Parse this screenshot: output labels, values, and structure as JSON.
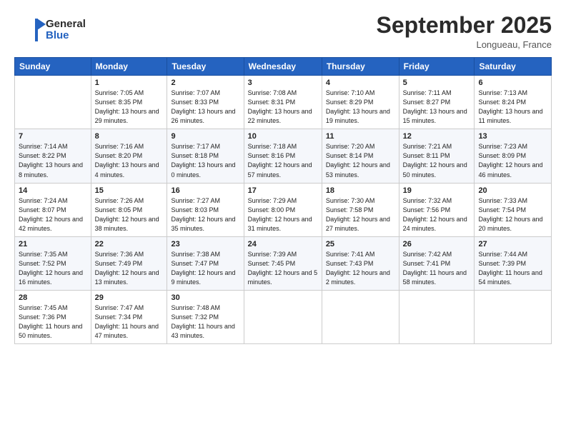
{
  "header": {
    "logo_line1": "General",
    "logo_line2": "Blue",
    "month": "September 2025",
    "location": "Longueau, France"
  },
  "days_of_week": [
    "Sunday",
    "Monday",
    "Tuesday",
    "Wednesday",
    "Thursday",
    "Friday",
    "Saturday"
  ],
  "weeks": [
    [
      {
        "day": "",
        "content": ""
      },
      {
        "day": "1",
        "content": "Sunrise: 7:05 AM\nSunset: 8:35 PM\nDaylight: 13 hours and 29 minutes."
      },
      {
        "day": "2",
        "content": "Sunrise: 7:07 AM\nSunset: 8:33 PM\nDaylight: 13 hours and 26 minutes."
      },
      {
        "day": "3",
        "content": "Sunrise: 7:08 AM\nSunset: 8:31 PM\nDaylight: 13 hours and 22 minutes."
      },
      {
        "day": "4",
        "content": "Sunrise: 7:10 AM\nSunset: 8:29 PM\nDaylight: 13 hours and 19 minutes."
      },
      {
        "day": "5",
        "content": "Sunrise: 7:11 AM\nSunset: 8:27 PM\nDaylight: 13 hours and 15 minutes."
      },
      {
        "day": "6",
        "content": "Sunrise: 7:13 AM\nSunset: 8:24 PM\nDaylight: 13 hours and 11 minutes."
      }
    ],
    [
      {
        "day": "7",
        "content": "Sunrise: 7:14 AM\nSunset: 8:22 PM\nDaylight: 13 hours and 8 minutes."
      },
      {
        "day": "8",
        "content": "Sunrise: 7:16 AM\nSunset: 8:20 PM\nDaylight: 13 hours and 4 minutes."
      },
      {
        "day": "9",
        "content": "Sunrise: 7:17 AM\nSunset: 8:18 PM\nDaylight: 13 hours and 0 minutes."
      },
      {
        "day": "10",
        "content": "Sunrise: 7:18 AM\nSunset: 8:16 PM\nDaylight: 12 hours and 57 minutes."
      },
      {
        "day": "11",
        "content": "Sunrise: 7:20 AM\nSunset: 8:14 PM\nDaylight: 12 hours and 53 minutes."
      },
      {
        "day": "12",
        "content": "Sunrise: 7:21 AM\nSunset: 8:11 PM\nDaylight: 12 hours and 50 minutes."
      },
      {
        "day": "13",
        "content": "Sunrise: 7:23 AM\nSunset: 8:09 PM\nDaylight: 12 hours and 46 minutes."
      }
    ],
    [
      {
        "day": "14",
        "content": "Sunrise: 7:24 AM\nSunset: 8:07 PM\nDaylight: 12 hours and 42 minutes."
      },
      {
        "day": "15",
        "content": "Sunrise: 7:26 AM\nSunset: 8:05 PM\nDaylight: 12 hours and 38 minutes."
      },
      {
        "day": "16",
        "content": "Sunrise: 7:27 AM\nSunset: 8:03 PM\nDaylight: 12 hours and 35 minutes."
      },
      {
        "day": "17",
        "content": "Sunrise: 7:29 AM\nSunset: 8:00 PM\nDaylight: 12 hours and 31 minutes."
      },
      {
        "day": "18",
        "content": "Sunrise: 7:30 AM\nSunset: 7:58 PM\nDaylight: 12 hours and 27 minutes."
      },
      {
        "day": "19",
        "content": "Sunrise: 7:32 AM\nSunset: 7:56 PM\nDaylight: 12 hours and 24 minutes."
      },
      {
        "day": "20",
        "content": "Sunrise: 7:33 AM\nSunset: 7:54 PM\nDaylight: 12 hours and 20 minutes."
      }
    ],
    [
      {
        "day": "21",
        "content": "Sunrise: 7:35 AM\nSunset: 7:52 PM\nDaylight: 12 hours and 16 minutes."
      },
      {
        "day": "22",
        "content": "Sunrise: 7:36 AM\nSunset: 7:49 PM\nDaylight: 12 hours and 13 minutes."
      },
      {
        "day": "23",
        "content": "Sunrise: 7:38 AM\nSunset: 7:47 PM\nDaylight: 12 hours and 9 minutes."
      },
      {
        "day": "24",
        "content": "Sunrise: 7:39 AM\nSunset: 7:45 PM\nDaylight: 12 hours and 5 minutes."
      },
      {
        "day": "25",
        "content": "Sunrise: 7:41 AM\nSunset: 7:43 PM\nDaylight: 12 hours and 2 minutes."
      },
      {
        "day": "26",
        "content": "Sunrise: 7:42 AM\nSunset: 7:41 PM\nDaylight: 11 hours and 58 minutes."
      },
      {
        "day": "27",
        "content": "Sunrise: 7:44 AM\nSunset: 7:39 PM\nDaylight: 11 hours and 54 minutes."
      }
    ],
    [
      {
        "day": "28",
        "content": "Sunrise: 7:45 AM\nSunset: 7:36 PM\nDaylight: 11 hours and 50 minutes."
      },
      {
        "day": "29",
        "content": "Sunrise: 7:47 AM\nSunset: 7:34 PM\nDaylight: 11 hours and 47 minutes."
      },
      {
        "day": "30",
        "content": "Sunrise: 7:48 AM\nSunset: 7:32 PM\nDaylight: 11 hours and 43 minutes."
      },
      {
        "day": "",
        "content": ""
      },
      {
        "day": "",
        "content": ""
      },
      {
        "day": "",
        "content": ""
      },
      {
        "day": "",
        "content": ""
      }
    ]
  ]
}
